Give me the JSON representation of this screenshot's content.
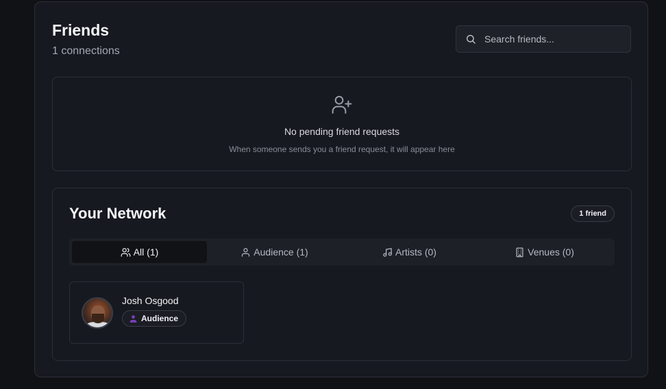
{
  "header": {
    "title": "Friends",
    "subtitle": "1 connections",
    "search_placeholder": "Search friends..."
  },
  "requests": {
    "icon": "user-plus-icon",
    "main_text": "No pending friend requests",
    "sub_text": "When someone sends you a friend request, it will appear here"
  },
  "network": {
    "title": "Your Network",
    "count_badge": "1 friend",
    "tabs": [
      {
        "label": "All (1)",
        "icon": "users-icon",
        "active": true
      },
      {
        "label": "Audience (1)",
        "icon": "user-icon",
        "active": false
      },
      {
        "label": "Artists (0)",
        "icon": "music-icon",
        "active": false
      },
      {
        "label": "Venues (0)",
        "icon": "building-icon",
        "active": false
      }
    ],
    "friends": [
      {
        "name": "Josh Osgood",
        "role": "Audience",
        "role_color": "#7b3fb8"
      }
    ]
  },
  "colors": {
    "background": "#111216",
    "panel": "#171920",
    "border": "#2c2f38",
    "accent_purple": "#7b3fb8"
  }
}
